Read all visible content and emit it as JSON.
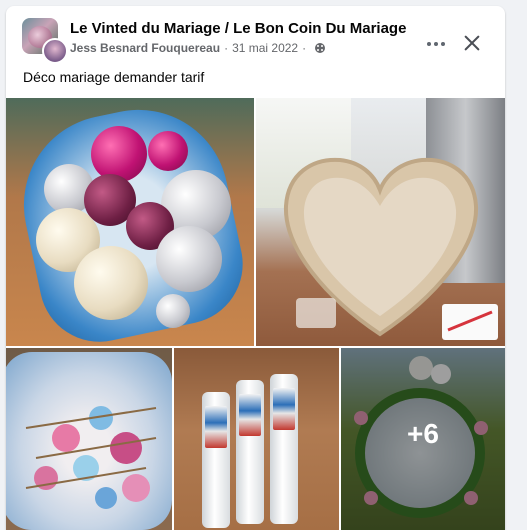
{
  "post": {
    "group_name": "Le Vinted du Mariage / Le Bon Coin Du Mariage",
    "author": "Jess Besnard Fouquereau",
    "date": "31 mai 2022",
    "separator": "·",
    "text": "Déco mariage demander tarif",
    "more_photos": "+6"
  },
  "icons": {
    "audience": "globe-icon",
    "more": "more-horizontal-icon",
    "close": "close-icon"
  },
  "colors": {
    "background": "#f0f2f5",
    "card": "#ffffff",
    "primary_text": "#050505",
    "secondary_text": "#65676b"
  }
}
